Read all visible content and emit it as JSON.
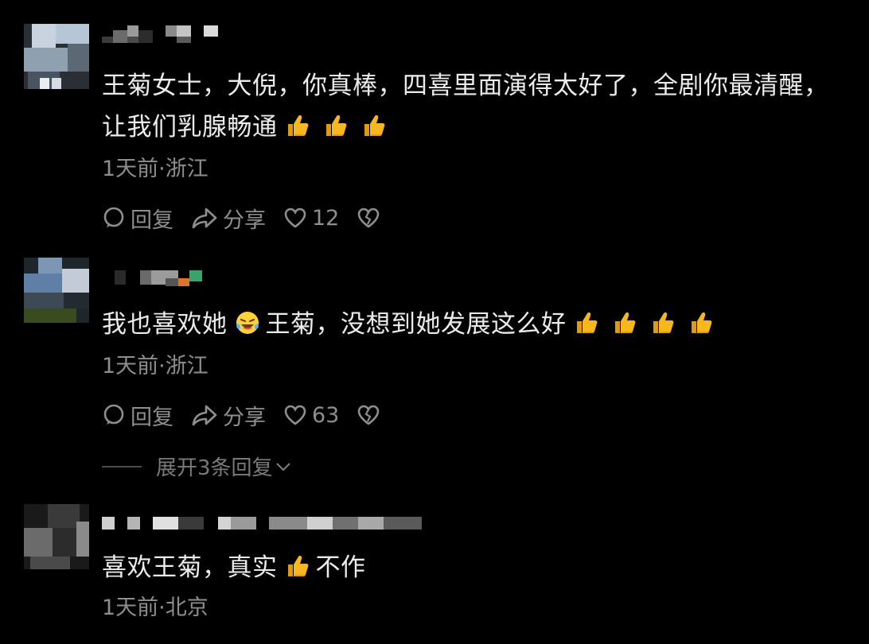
{
  "colors": {
    "background": "#000000",
    "text_primary": "#ebebeb",
    "text_secondary": "#8e8e8e",
    "thumb_emoji": "#f6b81c",
    "laugh_emoji": "#ffd13b"
  },
  "comments": [
    {
      "text_part1": "王菊女士，大倪，你真棒，四喜里面演得太好了，全剧你最清醒，让我们乳腺畅通",
      "emojis": [
        "thumbs-up",
        "thumbs-up",
        "thumbs-up"
      ],
      "meta": "1天前·浙江",
      "reply_label": "回复",
      "share_label": "分享",
      "like_count": "12"
    },
    {
      "text_part1": "我也喜欢她",
      "text_part2": "王菊，没想到她发展这么好",
      "emojis": [
        "laughing-tears",
        "thumbs-up",
        "thumbs-up",
        "thumbs-up",
        "thumbs-up"
      ],
      "meta": "1天前·浙江",
      "reply_label": "回复",
      "share_label": "分享",
      "like_count": "63",
      "expand_label": "展开3条回复"
    },
    {
      "text_part1": "喜欢王菊，真实",
      "text_part2": "不作",
      "emojis": [
        "thumbs-up"
      ],
      "meta": "1天前·北京"
    }
  ]
}
